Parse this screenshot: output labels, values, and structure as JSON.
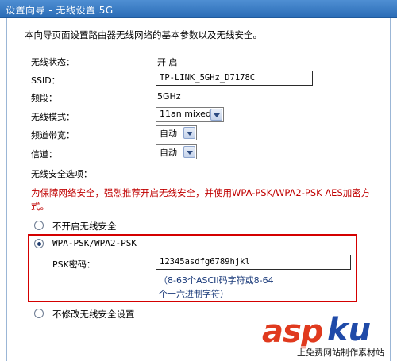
{
  "header": {
    "title": "设置向导 - 无线设置 5G"
  },
  "intro": "本向导页面设置路由器无线网络的基本参数以及无线安全。",
  "fields": {
    "wireless_status": {
      "label": "无线状态：",
      "value": "开 启"
    },
    "ssid": {
      "label": "SSID：",
      "value": "TP-LINK_5GHz_D7178C"
    },
    "band": {
      "label": "频段：",
      "value": "5GHz"
    },
    "mode": {
      "label": "无线模式：",
      "value": "11an mixed"
    },
    "bandwidth": {
      "label": "频道带宽：",
      "value": "自动"
    },
    "channel": {
      "label": "信道：",
      "value": "自动"
    }
  },
  "security": {
    "section_label": "无线安全选项：",
    "warning": "为保障网络安全，强烈推荐开启无线安全，并使用WPA-PSK/WPA2-PSK AES加密方式。",
    "option_off": "不开启无线安全",
    "option_wpa": "WPA-PSK/WPA2-PSK",
    "psk_label": "PSK密码：",
    "psk_value": "12345asdfg6789hjkl",
    "psk_hint_line1": "（8-63个ASCII码字符或8-64",
    "psk_hint_line2": "个十六进制字符）",
    "option_keep": "不修改无线安全设置",
    "selected": "wpa"
  },
  "watermark": {
    "brand_a": "asp",
    "brand_b": "ku",
    "sub": "上免费网站制作素材站"
  }
}
